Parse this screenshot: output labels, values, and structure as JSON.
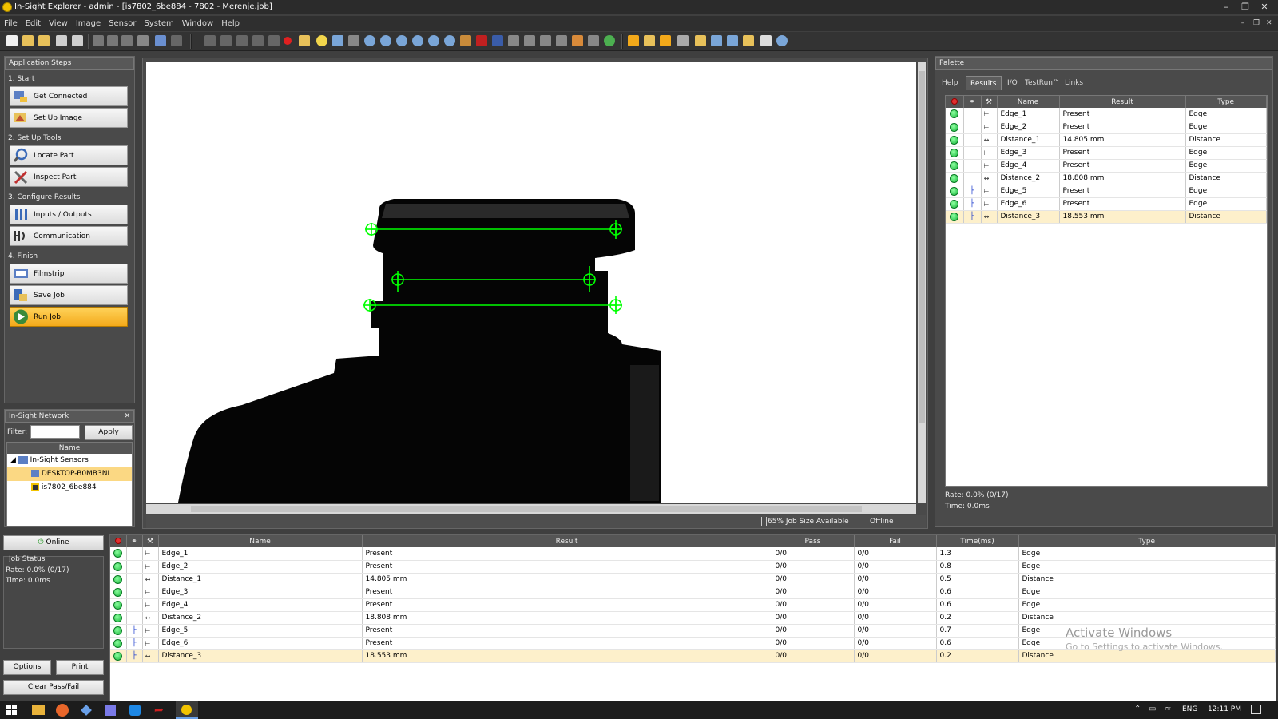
{
  "window": {
    "title": "In-Sight Explorer - admin - [is7802_6be884 - 7802 - Merenje.job]"
  },
  "menu": [
    "File",
    "Edit",
    "View",
    "Image",
    "Sensor",
    "System",
    "Window",
    "Help"
  ],
  "app_steps": {
    "header": "Application Steps",
    "sections": [
      {
        "title": "1. Start",
        "items": [
          "Get Connected",
          "Set Up Image"
        ]
      },
      {
        "title": "2. Set Up Tools",
        "items": [
          "Locate Part",
          "Inspect Part"
        ]
      },
      {
        "title": "3. Configure Results",
        "items": [
          "Inputs / Outputs",
          "Communication"
        ]
      },
      {
        "title": "4. Finish",
        "items": [
          "Filmstrip",
          "Save Job",
          "Run Job"
        ]
      }
    ]
  },
  "network": {
    "header": "In-Sight Network",
    "filter_label": "Filter:",
    "apply_label": "Apply",
    "column_name": "Name",
    "root": "In-Sight Sensors",
    "children": [
      "DESKTOP-B0MB3NL",
      "is7802_6be884"
    ]
  },
  "image_panel": {
    "status_job_size": "65% Job Size Available",
    "status_mode": "Offline"
  },
  "palette": {
    "header": "Palette",
    "tabs": [
      "Help",
      "Results",
      "I/O",
      "TestRun™",
      "Links"
    ],
    "active_tab": "Results",
    "columns": [
      "Name",
      "Result",
      "Type"
    ],
    "rows": [
      {
        "name": "Edge_1",
        "result": "Present",
        "type": "Edge",
        "icon": "edge-icon"
      },
      {
        "name": "Edge_2",
        "result": "Present",
        "type": "Edge",
        "icon": "edge-icon"
      },
      {
        "name": "Distance_1",
        "result": "14.805 mm",
        "type": "Distance",
        "icon": "distance-icon"
      },
      {
        "name": "Edge_3",
        "result": "Present",
        "type": "Edge",
        "icon": "edge-icon"
      },
      {
        "name": "Edge_4",
        "result": "Present",
        "type": "Edge",
        "icon": "edge-icon"
      },
      {
        "name": "Distance_2",
        "result": "18.808 mm",
        "type": "Distance",
        "icon": "distance-icon"
      },
      {
        "name": "Edge_5",
        "result": "Present",
        "type": "Edge",
        "icon": "edge-icon"
      },
      {
        "name": "Edge_6",
        "result": "Present",
        "type": "Edge",
        "icon": "edge-icon"
      },
      {
        "name": "Distance_3",
        "result": "18.553 mm",
        "type": "Distance",
        "icon": "distance-icon"
      }
    ],
    "rate": "Rate: 0.0% (0/17)",
    "time": "Time: 0.0ms"
  },
  "job_status": {
    "online_label": "Online",
    "title": "Job Status",
    "rate": "Rate: 0.0% (0/17)",
    "time": "Time: 0.0ms",
    "options_label": "Options",
    "print_label": "Print",
    "clear_label": "Clear Pass/Fail"
  },
  "results_table": {
    "columns": [
      "Name",
      "Result",
      "Pass",
      "Fail",
      "Time(ms)",
      "Type"
    ],
    "rows": [
      {
        "name": "Edge_1",
        "result": "Present",
        "pass": "0/0",
        "fail": "0/0",
        "time": "1.3",
        "type": "Edge"
      },
      {
        "name": "Edge_2",
        "result": "Present",
        "pass": "0/0",
        "fail": "0/0",
        "time": "0.8",
        "type": "Edge"
      },
      {
        "name": "Distance_1",
        "result": "14.805 mm",
        "pass": "0/0",
        "fail": "0/0",
        "time": "0.5",
        "type": "Distance"
      },
      {
        "name": "Edge_3",
        "result": "Present",
        "pass": "0/0",
        "fail": "0/0",
        "time": "0.6",
        "type": "Edge"
      },
      {
        "name": "Edge_4",
        "result": "Present",
        "pass": "0/0",
        "fail": "0/0",
        "time": "0.6",
        "type": "Edge"
      },
      {
        "name": "Distance_2",
        "result": "18.808 mm",
        "pass": "0/0",
        "fail": "0/0",
        "time": "0.2",
        "type": "Distance"
      },
      {
        "name": "Edge_5",
        "result": "Present",
        "pass": "0/0",
        "fail": "0/0",
        "time": "0.7",
        "type": "Edge"
      },
      {
        "name": "Edge_6",
        "result": "Present",
        "pass": "0/0",
        "fail": "0/0",
        "time": "0.6",
        "type": "Edge"
      },
      {
        "name": "Distance_3",
        "result": "18.553 mm",
        "pass": "0/0",
        "fail": "0/0",
        "time": "0.2",
        "type": "Distance"
      }
    ]
  },
  "watermark": {
    "line1": "Activate Windows",
    "line2": "Go to Settings to activate Windows."
  },
  "taskbar": {
    "lang": "ENG",
    "clock": "12:11 PM"
  },
  "colors": {
    "accent": "#f3a91a",
    "pass": "#16b53a",
    "overlay": "#00ff00",
    "selected_row": "#fdf0cb"
  }
}
